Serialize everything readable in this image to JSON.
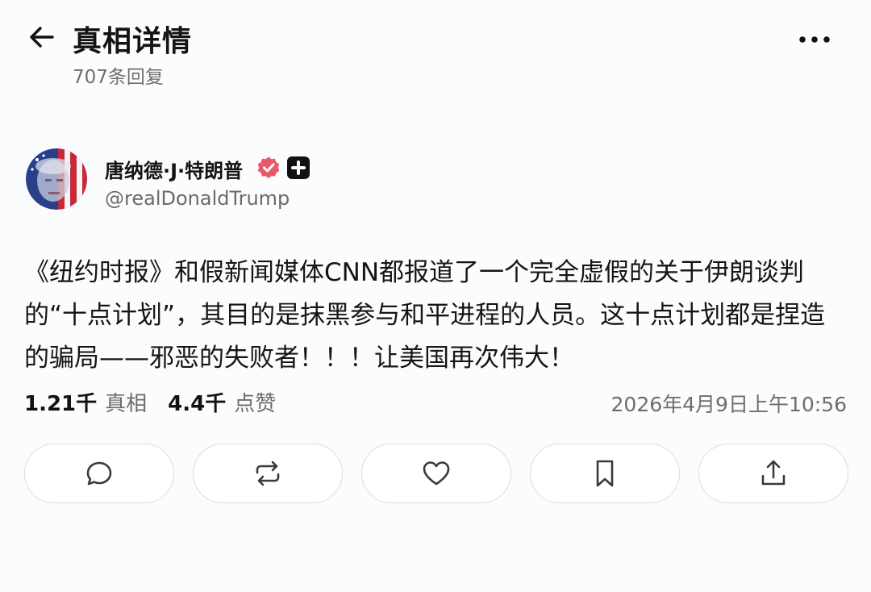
{
  "header": {
    "title": "真相详情",
    "reply_count": "707条回复"
  },
  "author": {
    "name": "唐纳德·J·特朗普",
    "handle": "@realDonaldTrump"
  },
  "post": {
    "text": "《纽约时报》和假新闻媒体CNN都报道了一个完全虚假的关于伊朗谈判的“十点计划”，其目的是抹黑参与和平进程的人员。这十点计划都是捏造的骗局——邪恶的失败者！！！让美国再次伟大！"
  },
  "stats": {
    "truths_count": "1.21千",
    "truths_label": "真相",
    "likes_count": "4.4千",
    "likes_label": "点赞",
    "timestamp": "2026年4月9日上午10:56"
  },
  "icons": {
    "back": "arrow-left-icon",
    "more": "more-horizontal-icon",
    "verified": "verified-badge-icon",
    "affiliate": "plus-badge-icon",
    "reply": "reply-bubble-icon",
    "retruth": "retruth-icon",
    "like": "heart-icon",
    "bookmark": "bookmark-icon",
    "share": "share-icon"
  },
  "colors": {
    "verified": "#e85a6a",
    "background": "#fbfcfd",
    "muted_text": "#6d6d6d"
  }
}
